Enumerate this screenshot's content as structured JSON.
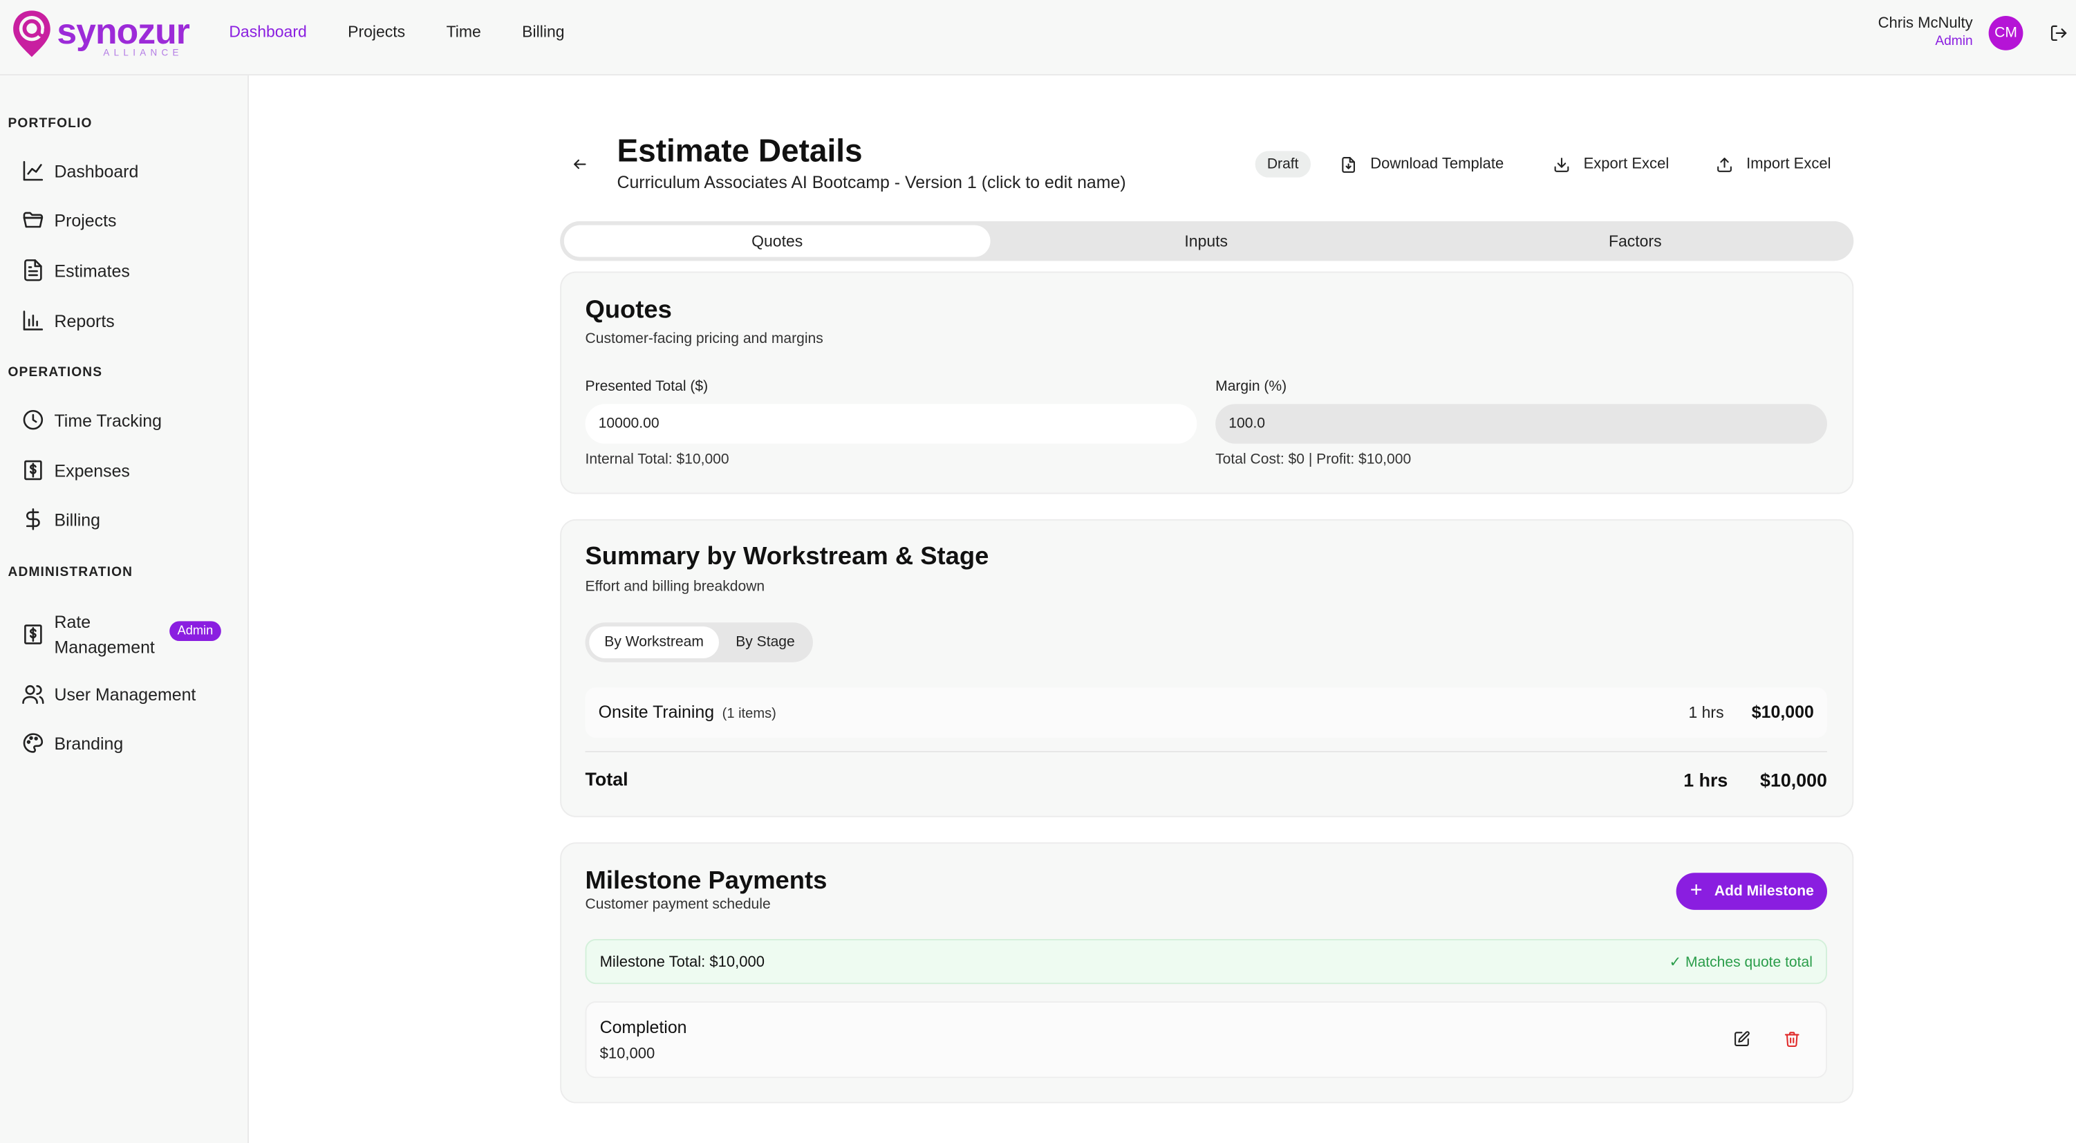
{
  "brand": {
    "name": "synozur",
    "tagline": "ALLIANCE",
    "color": "#9c2bd8"
  },
  "topnav": [
    "Dashboard",
    "Projects",
    "Time",
    "Billing"
  ],
  "user": {
    "name": "Chris McNulty",
    "role": "Admin",
    "initials": "CM"
  },
  "sidebar": {
    "portfolio_title": "PORTFOLIO",
    "portfolio": [
      {
        "label": "Dashboard",
        "icon": "chart-line-icon"
      },
      {
        "label": "Projects",
        "icon": "folder-icon"
      },
      {
        "label": "Estimates",
        "icon": "document-icon"
      },
      {
        "label": "Reports",
        "icon": "bar-chart-icon"
      }
    ],
    "operations_title": "OPERATIONS",
    "operations": [
      {
        "label": "Time Tracking",
        "icon": "clock-icon"
      },
      {
        "label": "Expenses",
        "icon": "receipt-dollar-icon"
      },
      {
        "label": "Billing",
        "icon": "dollar-icon"
      }
    ],
    "administration_title": "ADMINISTRATION",
    "administration": [
      {
        "label_line1": "Rate",
        "label_line2": "Management",
        "icon": "receipt-dollar-icon",
        "badge": "Admin"
      },
      {
        "label": "User Management",
        "icon": "users-icon"
      },
      {
        "label": "Branding",
        "icon": "palette-icon"
      }
    ]
  },
  "page": {
    "title": "Estimate Details",
    "subtitle": "Curriculum Associates AI Bootcamp - Version 1 (click to edit name)",
    "status": "Draft",
    "actions": {
      "download_template": "Download Template",
      "export_excel": "Export Excel",
      "import_excel": "Import Excel"
    },
    "tabs": [
      "Quotes",
      "Inputs",
      "Factors"
    ],
    "active_tab": "Quotes"
  },
  "quotes": {
    "title": "Quotes",
    "description": "Customer-facing pricing and margins",
    "presented_total_label": "Presented Total ($)",
    "presented_total_value": "10000.00",
    "internal_total": "Internal Total: $10,000",
    "margin_label": "Margin (%)",
    "margin_value": "100.0",
    "cost_profit": "Total Cost: $0 | Profit: $10,000"
  },
  "summary": {
    "title": "Summary by Workstream & Stage",
    "description": "Effort and billing breakdown",
    "toggle": [
      "By Workstream",
      "By Stage"
    ],
    "rows": [
      {
        "name": "Onsite Training",
        "count": "(1 items)",
        "hours": "1 hrs",
        "amount": "$10,000"
      }
    ],
    "total_label": "Total",
    "total_hours": "1 hrs",
    "total_amount": "$10,000"
  },
  "milestones": {
    "title": "Milestone Payments",
    "description": "Customer payment schedule",
    "add_label": "Add Milestone",
    "total_label": "Milestone Total: $10,000",
    "match_status": "✓ Matches quote total",
    "items": [
      {
        "name": "Completion",
        "amount": "$10,000"
      }
    ]
  },
  "colors": {
    "accent": "#8a1ee0",
    "avatar": "#b514d6",
    "success": "#2a9d4a",
    "danger": "#e02a2a"
  }
}
